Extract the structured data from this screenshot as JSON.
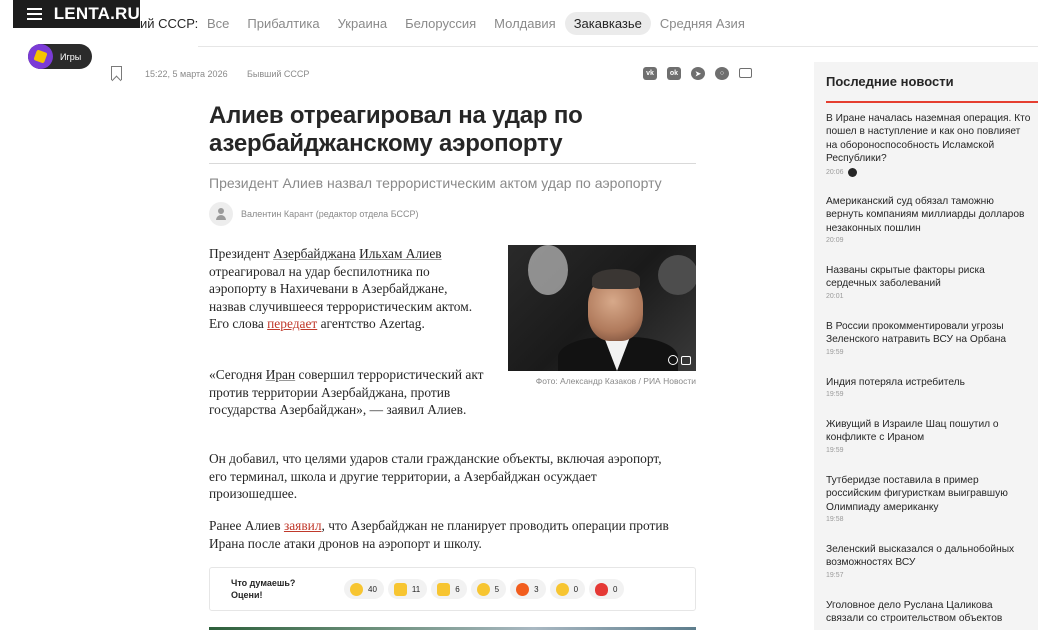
{
  "header": {
    "logo": "LENTA.RU",
    "section_label": "ий СССР:",
    "tabs": [
      {
        "label": "Все",
        "active": false
      },
      {
        "label": "Прибалтика",
        "active": false
      },
      {
        "label": "Украина",
        "active": false
      },
      {
        "label": "Белоруссия",
        "active": false
      },
      {
        "label": "Молдавия",
        "active": false
      },
      {
        "label": "Закавказье",
        "active": true
      },
      {
        "label": "Средняя Азия",
        "active": false
      }
    ],
    "games_label": "Игры"
  },
  "meta": {
    "date": "15:22, 5 марта 2026",
    "rubric": "Бывший СССР",
    "share_icons": [
      "vk-icon",
      "ok-icon",
      "telegram-icon",
      "max-icon",
      "mail-icon"
    ]
  },
  "article": {
    "title": "Алиев отреагировал на удар по азербайджанскому аэропорту",
    "subtitle": "Президент Алиев назвал террористическим актом удар по аэропорту",
    "author": "Валентин Карант (редактор отдела БССР)",
    "p1": {
      "t0": "Президент ",
      "link1": "Азербайджана",
      "t1": " ",
      "link2": "Ильхам Алиев",
      "t2": " отреагировал на удар беспилотника по аэропорту в Нахичевани в Азербайджане, назвав случившееся террористическим актом. Его слова ",
      "link3": "передает",
      "t3": " агентство Azertag."
    },
    "p2": {
      "t0": "«Сегодня ",
      "link1": "Иран",
      "t1": " совершил террористический акт против территории Азербайджана, против государства Азербайджан», — заявил Алиев."
    },
    "p3": "Он добавил, что целями ударов стали гражданские объекты, включая аэропорт, его терминал, школа и другие территории, а Азербайджан осуждает произошедшее.",
    "p4": {
      "t0": "Ранее Алиев ",
      "link1": "заявил",
      "t1": ", что Азербайджан не планирует проводить операции против Ирана после атаки дронов на аэропорт и школу."
    },
    "photo_caption": "Фото: Александр Казаков / РИА Новости"
  },
  "reactions": {
    "question_line1": "Что думаешь?",
    "question_line2": "Оцени!",
    "items": [
      {
        "icon": "laugh-emoji-icon",
        "count": "40"
      },
      {
        "icon": "thumbs-up-icon",
        "count": "11"
      },
      {
        "icon": "thumbs-down-icon",
        "count": "6"
      },
      {
        "icon": "shocked-emoji-icon",
        "count": "5"
      },
      {
        "icon": "angry-emoji-icon",
        "count": "3"
      },
      {
        "icon": "sad-emoji-icon",
        "count": "0"
      },
      {
        "icon": "heart-icon",
        "count": "0"
      }
    ]
  },
  "sidebar": {
    "title": "Последние новости",
    "items": [
      {
        "title": "В Иране началась наземная операция. Кто пошел в наступление и как оно повлияет на обороноспособность Исламской Республики?",
        "time": "20:06"
      },
      {
        "title": "Американский суд обязал таможню вернуть компаниям миллиарды долларов незаконных пошлин",
        "time": "20:09"
      },
      {
        "title": "Названы скрытые факторы риска сердечных заболеваний",
        "time": "20:01"
      },
      {
        "title": "В России прокомментировали угрозы Зеленского натравить ВСУ на Орбана",
        "time": "19:59"
      },
      {
        "title": "Индия потеряла истребитель",
        "time": "19:59"
      },
      {
        "title": "Живущий в Израиле Шац пошутил о конфликте с Ираном",
        "time": "19:59"
      },
      {
        "title": "Тутберидзе поставила в пример российским фигуристкам выигравшую Олимпиаду американку",
        "time": "19:58"
      },
      {
        "title": "Зеленский высказался о дальнобойных возможностях ВСУ",
        "time": "19:57"
      },
      {
        "title": "Уголовное дело Руслана Цаликова связали со строительством объектов",
        "time": ""
      }
    ]
  }
}
